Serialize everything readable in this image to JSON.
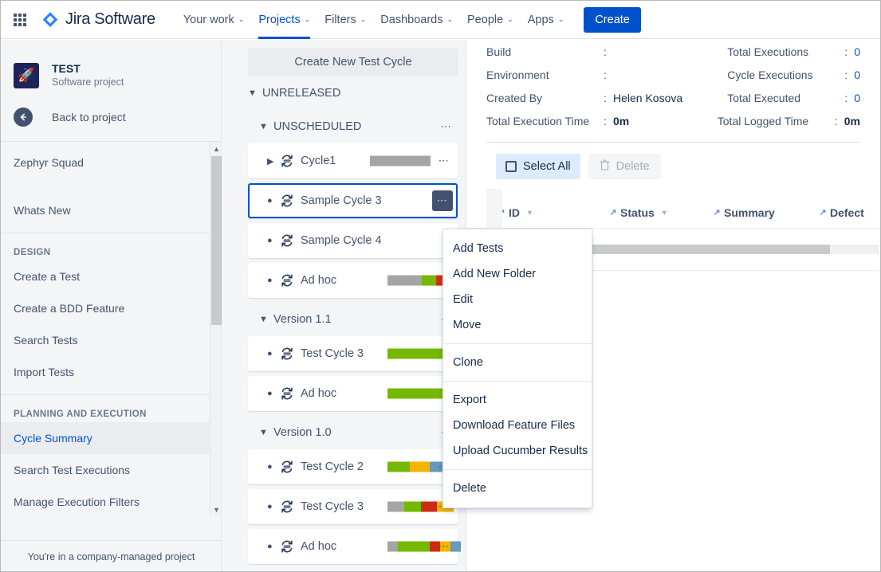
{
  "topnav": {
    "app_switcher": "app-switcher",
    "brand": "Jira Software",
    "items": [
      {
        "label": "Your work",
        "caret": "⌄",
        "active": false
      },
      {
        "label": "Projects",
        "caret": "⌄",
        "active": true
      },
      {
        "label": "Filters",
        "caret": "⌄",
        "active": false
      },
      {
        "label": "Dashboards",
        "caret": "⌄",
        "active": false
      },
      {
        "label": "People",
        "caret": "⌄",
        "active": false
      },
      {
        "label": "Apps",
        "caret": "⌄",
        "active": false
      }
    ],
    "create_label": "Create",
    "accent": "#0052CC"
  },
  "sidebar": {
    "project_name": "TEST",
    "project_type": "Software project",
    "project_icon": "rocket-icon",
    "back_label": "Back to project",
    "items": [
      {
        "label": "Zephyr Squad",
        "selected": false
      },
      {
        "label": "Whats New",
        "selected": false
      }
    ],
    "section_design": "DESIGN",
    "design_items": [
      {
        "label": "Create a Test",
        "selected": false
      },
      {
        "label": "Create a BDD Feature",
        "selected": false
      },
      {
        "label": "Search Tests",
        "selected": false
      },
      {
        "label": "Import Tests",
        "selected": false
      }
    ],
    "section_planning": "PLANNING AND EXECUTION",
    "planning_items": [
      {
        "label": "Cycle Summary",
        "selected": true
      },
      {
        "label": "Search Test Executions",
        "selected": false
      },
      {
        "label": "Manage Execution Filters",
        "selected": false
      }
    ],
    "footer": "You're in a company-managed project"
  },
  "tree": {
    "create_button": "Create New Test Cycle",
    "groups": [
      {
        "label": "UNRELEASED",
        "level": 1,
        "expanded": true,
        "menu": false
      },
      {
        "label": "UNSCHEDULED",
        "level": 2,
        "expanded": true,
        "menu": true
      }
    ],
    "unscheduled_cycles": [
      {
        "label": "Cycle1",
        "expandable": true,
        "selected": false,
        "menu_active": false,
        "bar": [
          {
            "color": "#A5A5A5",
            "width": 76
          }
        ]
      },
      {
        "label": "Sample Cycle 3",
        "expandable": false,
        "selected": true,
        "menu_active": true,
        "bar": []
      },
      {
        "label": "Sample Cycle 4",
        "expandable": false,
        "selected": false,
        "menu_active": false,
        "bar": []
      },
      {
        "label": "Ad hoc",
        "expandable": false,
        "selected": false,
        "menu_active": false,
        "bar": [
          {
            "color": "#A5A5A5",
            "width": 43
          },
          {
            "color": "#75B800",
            "width": 18
          },
          {
            "color": "#D42E12",
            "width": 11
          },
          {
            "color": "#F5A700",
            "width": 4
          },
          {
            "color": "#6699BB",
            "width": 5
          }
        ]
      }
    ],
    "version_11": {
      "label": "Version 1.1",
      "level": 2,
      "expanded": true,
      "menu": true
    },
    "version_11_cycles": [
      {
        "label": "Test Cycle 3",
        "expandable": false,
        "selected": false,
        "menu_active": false,
        "bar": [
          {
            "color": "#75B800",
            "width": 78
          }
        ]
      },
      {
        "label": "Ad hoc",
        "expandable": false,
        "selected": false,
        "menu_active": false,
        "bar": [
          {
            "color": "#75B800",
            "width": 78
          }
        ]
      }
    ],
    "version_10": {
      "label": "Version 1.0",
      "level": 2,
      "expanded": true,
      "menu": true
    },
    "version_10_cycles": [
      {
        "label": "Test Cycle 2",
        "expandable": false,
        "selected": false,
        "menu_active": false,
        "bar": [
          {
            "color": "#75B800",
            "width": 28
          },
          {
            "color": "#F5B400",
            "width": 25
          },
          {
            "color": "#6699BB",
            "width": 25
          }
        ]
      },
      {
        "label": "Test Cycle 3",
        "expandable": false,
        "selected": false,
        "menu_active": false,
        "bar": [
          {
            "color": "#A5A5A5",
            "width": 21
          },
          {
            "color": "#75B800",
            "width": 21
          },
          {
            "color": "#CC2B10",
            "width": 20
          },
          {
            "color": "#F5B400",
            "width": 21
          }
        ]
      },
      {
        "label": "Ad hoc",
        "expandable": false,
        "selected": false,
        "menu_active": false,
        "bar": [
          {
            "color": "#A5A5A5",
            "width": 13
          },
          {
            "color": "#75B800",
            "width": 40
          },
          {
            "color": "#CC2B10",
            "width": 13
          },
          {
            "color": "#F5B400",
            "width": 13
          },
          {
            "color": "#6699BB",
            "width": 13
          }
        ]
      }
    ]
  },
  "context_menu": {
    "items": [
      {
        "label": "Add Tests",
        "sep_after": false
      },
      {
        "label": "Add New Folder",
        "sep_after": false
      },
      {
        "label": "Edit",
        "sep_after": false
      },
      {
        "label": "Move",
        "sep_after": true
      },
      {
        "label": "Clone",
        "sep_after": true
      },
      {
        "label": "Export",
        "sep_after": false
      },
      {
        "label": "Download Feature Files",
        "sep_after": false
      },
      {
        "label": "Upload Cucumber Results",
        "sep_after": true
      },
      {
        "label": "Delete",
        "sep_after": false
      }
    ]
  },
  "details": {
    "left_rows": [
      {
        "key": "Build",
        "value": ""
      },
      {
        "key": "Environment",
        "value": ""
      },
      {
        "key": "Created By",
        "value": "Helen Kosova"
      },
      {
        "key": "Total Execution Time",
        "value": "0m"
      }
    ],
    "right_rows": [
      {
        "key": "Total Executions",
        "value": "0",
        "style": "blue"
      },
      {
        "key": "Cycle Executions",
        "value": "0",
        "style": "blue"
      },
      {
        "key": "Total Executed",
        "value": "0",
        "style": "blue"
      },
      {
        "key": "Total Logged Time",
        "value": "0m",
        "style": "bold"
      }
    ]
  },
  "toolbar": {
    "select_all_label": "Select All",
    "delete_label": "Delete",
    "delete_icon": "trash-icon",
    "checkbox_icon": "checkbox-icon"
  },
  "table": {
    "columns": [
      {
        "label": "ID",
        "pin": true,
        "sortable": true
      },
      {
        "label": "Status",
        "pin": true,
        "sortable": true
      },
      {
        "label": "Summary",
        "pin": true,
        "sortable": false
      },
      {
        "label": "Defect",
        "pin": true,
        "sortable": false
      }
    ],
    "rows": []
  }
}
